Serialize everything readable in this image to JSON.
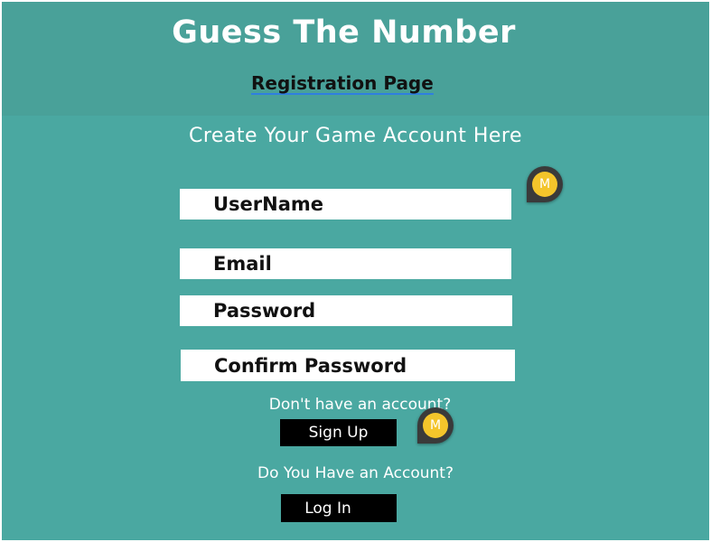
{
  "header": {
    "title": "Guess The Number",
    "subtitle": "Registration Page"
  },
  "form": {
    "heading": "Create Your Game Account Here",
    "fields": {
      "username": "UserName",
      "email": "Email",
      "password": "Password",
      "confirm_password": "Confirm Password"
    }
  },
  "signup": {
    "prompt": "Don't have an account?",
    "button_label": "Sign Up"
  },
  "login": {
    "prompt": "Do You Have an Account?",
    "button_label": "Log In"
  },
  "markers": [
    {
      "label": "M"
    },
    {
      "label": "M"
    }
  ],
  "colors": {
    "background": "#4aa8a1",
    "header": "#49a199",
    "button": "#000000",
    "marker": "#f4c52b"
  }
}
